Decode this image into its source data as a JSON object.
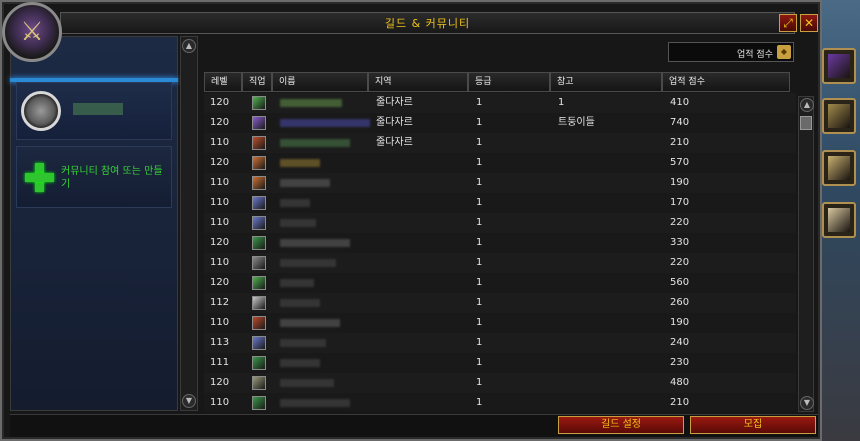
{
  "window": {
    "title": "길드 & 커뮤니티",
    "minimize_glyph": "⤢",
    "close_glyph": "✕"
  },
  "emblem": {
    "icon": "guild-crest-icon",
    "glyph": "⚔"
  },
  "sidebar": {
    "community_icon": "community-crest-icon",
    "join_label": "커뮤니티 참여 또는 만들기"
  },
  "filter": {
    "label": "업적 점수",
    "arrow": "◆"
  },
  "columns": [
    "레벨",
    "직업",
    "이름",
    "지역",
    "등급",
    "참고",
    "업적 점수"
  ],
  "rows": [
    {
      "level": "120",
      "class_color": "#4fb34f",
      "zone": "줄다자르",
      "rank": "1",
      "note": "1",
      "score": "410",
      "name_color": "#4a6a3a",
      "name_w": 62
    },
    {
      "level": "120",
      "class_color": "#8a5fd0",
      "zone": "줄다자르",
      "rank": "1",
      "note": "트둥이들",
      "score": "740",
      "name_color": "#3a3a7a",
      "name_w": 90
    },
    {
      "level": "110",
      "class_color": "#c0502a",
      "zone": "줄다자르",
      "rank": "1",
      "note": "",
      "score": "210",
      "name_color": "#3a5a3a",
      "name_w": 70
    },
    {
      "level": "120",
      "class_color": "#d07030",
      "zone": "",
      "rank": "1",
      "note": "",
      "score": "570",
      "name_color": "#6a5a2a",
      "name_w": 40
    },
    {
      "level": "110",
      "class_color": "#d07030",
      "zone": "",
      "rank": "1",
      "note": "",
      "score": "190",
      "name_color": "#4a4a4a",
      "name_w": 50
    },
    {
      "level": "110",
      "class_color": "#6a7ad0",
      "zone": "",
      "rank": "1",
      "note": "",
      "score": "170",
      "name_color": "#3a3a3a",
      "name_w": 30
    },
    {
      "level": "110",
      "class_color": "#6a7ad0",
      "zone": "",
      "rank": "1",
      "note": "",
      "score": "220",
      "name_color": "#3a3a3a",
      "name_w": 36
    },
    {
      "level": "120",
      "class_color": "#3a9a4a",
      "zone": "",
      "rank": "1",
      "note": "",
      "score": "330",
      "name_color": "#4a4a4a",
      "name_w": 70
    },
    {
      "level": "110",
      "class_color": "#8a8a8a",
      "zone": "",
      "rank": "1",
      "note": "",
      "score": "220",
      "name_color": "#3a3a3a",
      "name_w": 56
    },
    {
      "level": "120",
      "class_color": "#4fb34f",
      "zone": "",
      "rank": "1",
      "note": "",
      "score": "560",
      "name_color": "#3a3a3a",
      "name_w": 34
    },
    {
      "level": "112",
      "class_color": "#c8c8c8",
      "zone": "",
      "rank": "1",
      "note": "",
      "score": "260",
      "name_color": "#3a3a3a",
      "name_w": 40
    },
    {
      "level": "110",
      "class_color": "#c04a2a",
      "zone": "",
      "rank": "1",
      "note": "",
      "score": "190",
      "name_color": "#4a4a4a",
      "name_w": 60
    },
    {
      "level": "113",
      "class_color": "#6a7ad0",
      "zone": "",
      "rank": "1",
      "note": "",
      "score": "240",
      "name_color": "#3a3a3a",
      "name_w": 46
    },
    {
      "level": "111",
      "class_color": "#3a9a4a",
      "zone": "",
      "rank": "1",
      "note": "",
      "score": "230",
      "name_color": "#3a3a3a",
      "name_w": 40
    },
    {
      "level": "120",
      "class_color": "#9a9a7a",
      "zone": "",
      "rank": "1",
      "note": "",
      "score": "480",
      "name_color": "#3a3a3a",
      "name_w": 54
    },
    {
      "level": "110",
      "class_color": "#3a9a4a",
      "zone": "",
      "rank": "1",
      "note": "",
      "score": "210",
      "name_color": "#3a3a3a",
      "name_w": 70
    }
  ],
  "buttons": {
    "guild_settings": "길드 설정",
    "recruit": "모집"
  },
  "side_tabs": [
    {
      "icon": "guild-banner-icon",
      "color": "#6a3aa0"
    },
    {
      "icon": "creature-portrait-icon",
      "color": "#a08a4a"
    },
    {
      "icon": "gift-box-icon",
      "color": "#c8b070"
    },
    {
      "icon": "scroll-paper-icon",
      "color": "#d8c8a0"
    }
  ]
}
